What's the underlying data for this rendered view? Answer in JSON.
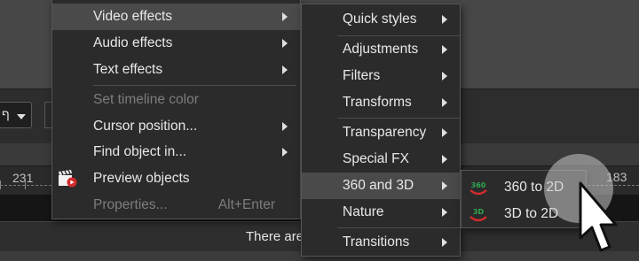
{
  "toolbar": {
    "combo_value": "ף"
  },
  "ruler": {
    "left_number": "231",
    "right_number": "183"
  },
  "status": {
    "message": "There are"
  },
  "main_menu": {
    "items": [
      {
        "label": "Video effects",
        "has_submenu": true,
        "highlighted": true
      },
      {
        "label": "Audio effects",
        "has_submenu": true
      },
      {
        "label": "Text effects",
        "has_submenu": true
      },
      {
        "label": "Set timeline color",
        "disabled": true
      },
      {
        "label": "Cursor position...",
        "has_submenu": true
      },
      {
        "label": "Find object in...",
        "has_submenu": true
      },
      {
        "label": "Preview objects",
        "icon": "clapperboard-icon"
      },
      {
        "label": "Properties...",
        "shortcut": "Alt+Enter",
        "disabled": true
      }
    ]
  },
  "video_effects_menu": {
    "items": [
      {
        "label": "Quick styles"
      },
      {
        "label": "Adjustments"
      },
      {
        "label": "Filters"
      },
      {
        "label": "Transforms"
      },
      {
        "label": "Transparency"
      },
      {
        "label": "Special FX"
      },
      {
        "label": "360 and 3D",
        "highlighted": true
      },
      {
        "label": "Nature"
      },
      {
        "label": "Transitions"
      }
    ]
  },
  "three_sixty_menu": {
    "items": [
      {
        "label": "360 to 2D",
        "icon": "360-badge-icon",
        "badge_text": "360"
      },
      {
        "label": "3D to 2D",
        "icon": "3d-badge-icon",
        "badge_text": "3D"
      }
    ]
  },
  "colors": {
    "menu_bg": "#2b2b2b",
    "highlight": "#4a4a4a",
    "badge_green": "#2fa84f",
    "badge_red": "#d22b2b"
  }
}
